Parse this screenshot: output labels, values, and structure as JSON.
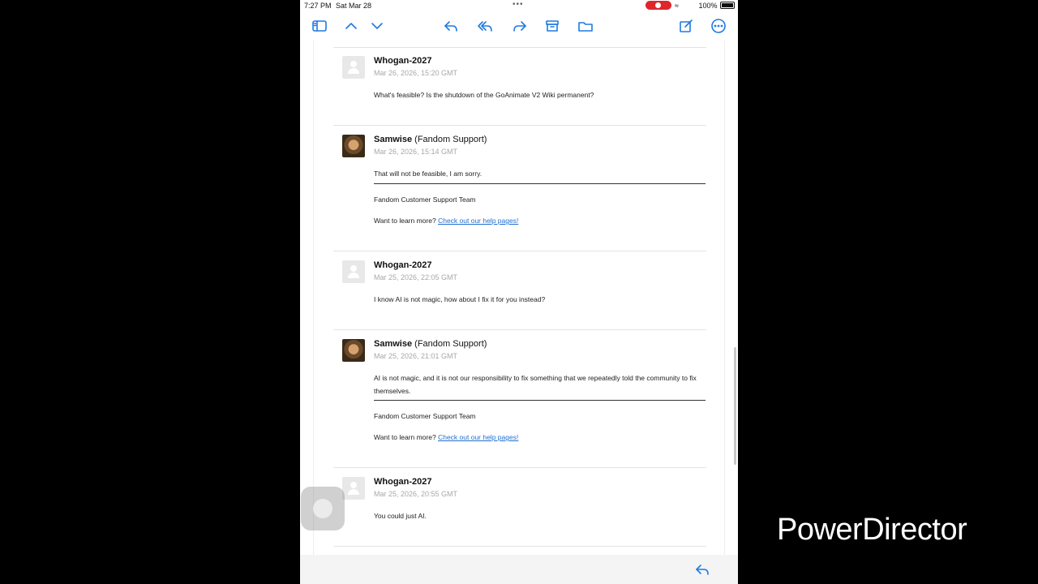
{
  "status_bar": {
    "time": "7:27 PM",
    "date": "Sat Mar 28",
    "battery": "100%"
  },
  "toolbar": {
    "icons": [
      "sidebar-icon",
      "chevron-up-icon",
      "chevron-down-icon",
      "reply-icon",
      "reply-all-icon",
      "forward-icon",
      "archive-icon",
      "folder-icon",
      "compose-icon",
      "more-icon"
    ],
    "accent": "#1f7ae0"
  },
  "messages": [
    {
      "author": "Whogan-2027",
      "role": "",
      "timestamp": "Mar 26, 2026, 15:20 GMT",
      "body": "What's feasible? Is the shutdown of the GoAnimate V2 Wiki permanent?"
    },
    {
      "author": "Samwise",
      "role": "(Fandom Support)",
      "timestamp": "Mar 26, 2026, 15:14 GMT",
      "body": "That will not be feasible, I am sorry.",
      "signature": "Fandom Customer Support Team",
      "help_text": "Want to learn more?",
      "help_link": "Check out our help pages!"
    },
    {
      "author": "Whogan-2027",
      "role": "",
      "timestamp": "Mar 25, 2026, 22:05 GMT",
      "body": "I know AI is not magic, how about I fix it for you instead?"
    },
    {
      "author": "Samwise",
      "role": "(Fandom Support)",
      "timestamp": "Mar 25, 2026, 21:01 GMT",
      "body": "AI is not magic, and it is not our responsibility to fix something that we repeatedly told the community to fix themselves.",
      "signature": "Fandom Customer Support Team",
      "help_text": "Want to learn more?",
      "help_link": "Check out our help pages!"
    },
    {
      "author": "Whogan-2027",
      "role": "",
      "timestamp": "Mar 25, 2026, 20:55 GMT",
      "body": "You could just AI."
    }
  ],
  "bottom_bar": {
    "icon": "reply-icon"
  },
  "overlay": {
    "watermark": "PowerDirector"
  }
}
